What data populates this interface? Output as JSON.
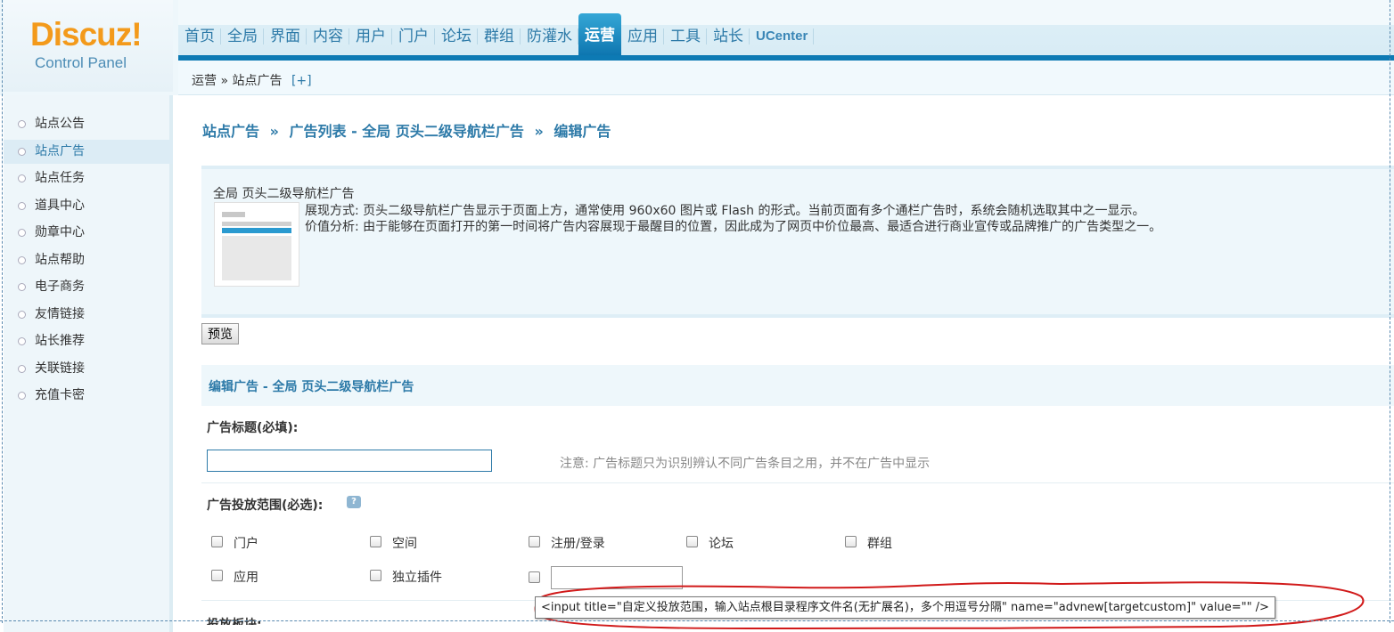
{
  "logo": {
    "brand": "Discuz!",
    "subtitle": "Control Panel"
  },
  "nav": {
    "items": [
      "首页",
      "全局",
      "界面",
      "内容",
      "用户",
      "门户",
      "论坛",
      "群组",
      "防灌水",
      "运营",
      "应用",
      "工具",
      "站长",
      "UCenter"
    ],
    "active": "运营"
  },
  "breadcrumb": {
    "section": "运营",
    "separator": "»",
    "page": "站点广告",
    "plus": "[+]"
  },
  "sidebar": {
    "items": [
      "站点公告",
      "站点广告",
      "站点任务",
      "道具中心",
      "勋章中心",
      "站点帮助",
      "电子商务",
      "友情链接",
      "站长推荐",
      "关联链接",
      "充值卡密"
    ],
    "active": "站点广告"
  },
  "page_title": {
    "part1": "站点广告",
    "sep": "»",
    "part2": "广告列表 - 全局 页头二级导航栏广告",
    "part3": "编辑广告"
  },
  "ad_type": {
    "name": "全局 页头二级导航栏广告",
    "display_mode": "展现方式: 页头二级导航栏广告显示于页面上方，通常使用 960x60 图片或 Flash 的形式。当前页面有多个通栏广告时，系统会随机选取其中之一显示。",
    "value_analysis": "价值分析: 由于能够在页面打开的第一时间将广告内容展现于最醒目的位置，因此成为了网页中价位最高、最适合进行商业宣传或品牌推广的广告类型之一。"
  },
  "preview_button": "预览",
  "edit_section_title": "编辑广告 - 全局 页头二级导航栏广告",
  "ad_title_field": {
    "label": "广告标题(必填):",
    "value": "",
    "note": "注意: 广告标题只为识别辨认不同广告条目之用，并不在广告中显示"
  },
  "target_scope": {
    "label": "广告投放范围(必选):",
    "help_icon": "question-icon",
    "options": [
      "门户",
      "空间",
      "注册/登录",
      "论坛",
      "群组",
      "应用",
      "独立插件"
    ],
    "custom_value": ""
  },
  "tooltip": "<input title=\"自定义投放范围，输入站点根目录程序文件名(无扩展名)，多个用逗号分隔\" name=\"advnew[targetcustom]\" value=\"\" />",
  "next_label_cut": "投放板块:",
  "annotation_color": "#d11a1a",
  "accent_color": "#0d7ab4"
}
